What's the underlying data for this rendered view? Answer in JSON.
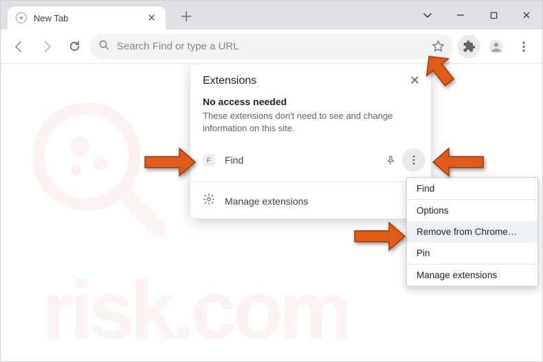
{
  "tab": {
    "title": "New Tab"
  },
  "omnibox": {
    "placeholder": "Search Find or type a URL"
  },
  "ext_popup": {
    "title": "Extensions",
    "section_title": "No access needed",
    "section_desc": "These extensions don't need to see and change information on this site.",
    "item_name": "Find",
    "manage_label": "Manage extensions"
  },
  "ctx": {
    "find": "Find",
    "options": "Options",
    "remove": "Remove from Chrome…",
    "pin": "Pin",
    "manage": "Manage extensions"
  }
}
